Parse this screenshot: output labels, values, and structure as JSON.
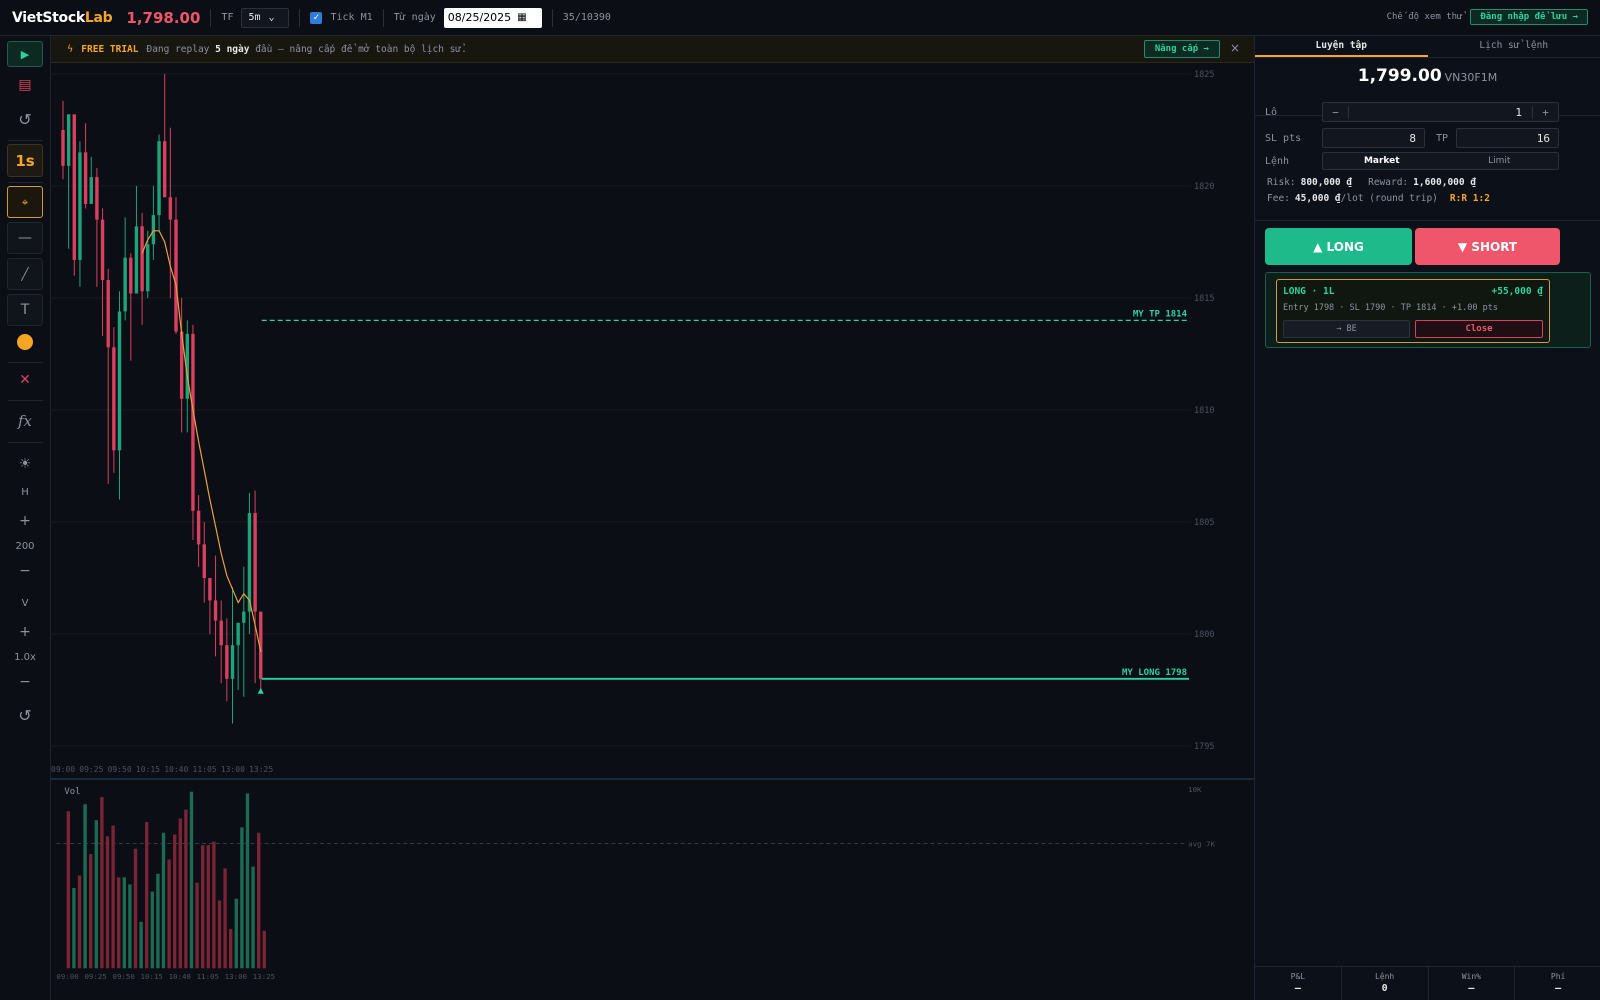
{
  "app": {
    "logo_main": "VietStock",
    "logo_accent": "Lab",
    "price": "1,798.00"
  },
  "topbar": {
    "tf_label": "TF",
    "tf_value": "5m",
    "tick_label": "Tick M1",
    "tick_check": "✓",
    "from_label": "Từ ngày",
    "date_value": "08/25/2025",
    "counter": "35/10390",
    "trial_mode": "Chế độ xem thử",
    "login_label": "Đăng nhập để lưu →"
  },
  "toolbar": {
    "speed": "1s",
    "h_label": "H",
    "h_value": "200",
    "v_label": "V",
    "v_value": "1.0x",
    "plus": "+",
    "minus": "−"
  },
  "banner": {
    "badge": "FREE TRIAL",
    "msg_pre": "Đang replay",
    "msg_bold": "5 ngày",
    "msg_post": "đầu — nâng cấp để mở toàn bộ lịch sử.",
    "upgrade": "Nâng cấp →",
    "close": "×"
  },
  "chart_data": {
    "type": "candlestick",
    "y_ticks": [
      "1825",
      "1820",
      "1815",
      "1810",
      "1805",
      "1800",
      "1795"
    ],
    "y_values": [
      1825,
      1820,
      1815,
      1810,
      1805,
      1800,
      1795
    ],
    "ylim": [
      1794.5,
      1825.5
    ],
    "x_ticks": [
      "09:00",
      "09:25",
      "09:50",
      "10:15",
      "10:40",
      "11:05",
      "13:00",
      "13:25"
    ],
    "tp_label": "MY TP 1814",
    "tp_value": 1814,
    "entry_label": "MY LONG 1798",
    "entry_value": 1798,
    "colors": {
      "up": "#1fa37a",
      "down": "#d9405f",
      "ma": "#e8a23a",
      "tp": "#27d3a0"
    },
    "candles": [
      [
        1822.5,
        1823.8,
        1820.3,
        1820.9
      ],
      [
        1820.9,
        1821.4,
        1817.2,
        1823.2
      ],
      [
        1823.2,
        1823.0,
        1816.0,
        1816.7
      ],
      [
        1816.7,
        1822.0,
        1815.5,
        1821.5
      ],
      [
        1821.5,
        1822.8,
        1819.0,
        1819.2
      ],
      [
        1819.2,
        1821.3,
        1819.4,
        1820.4
      ],
      [
        1820.4,
        1820.8,
        1815.5,
        1818.5
      ],
      [
        1818.5,
        1819.0,
        1813.3,
        1815.8
      ],
      [
        1815.8,
        1816.3,
        1806.7,
        1812.8
      ],
      [
        1812.8,
        1813.7,
        1807.2,
        1808.2
      ],
      [
        1808.2,
        1815.3,
        1806.0,
        1814.4
      ],
      [
        1814.4,
        1818.6,
        1814.0,
        1816.8
      ],
      [
        1816.8,
        1817.0,
        1812.2,
        1815.2
      ],
      [
        1815.2,
        1820.0,
        1815.4,
        1818.2
      ],
      [
        1818.2,
        1818.8,
        1813.8,
        1815.3
      ],
      [
        1815.3,
        1818.0,
        1815.0,
        1817.4
      ],
      [
        1817.4,
        1820.0,
        1816.7,
        1818.7
      ],
      [
        1818.7,
        1822.3,
        1818.0,
        1822.0
      ],
      [
        1822.0,
        1825.0,
        1819.5,
        1819.5
      ],
      [
        1819.5,
        1822.6,
        1815.0,
        1818.5
      ],
      [
        1818.5,
        1819.5,
        1813.4,
        1813.5
      ],
      [
        1813.5,
        1815.0,
        1809.0,
        1810.5
      ],
      [
        1810.5,
        1814.0,
        1809.0,
        1813.4
      ],
      [
        1813.4,
        1813.8,
        1804.2,
        1805.5
      ],
      [
        1805.5,
        1806.2,
        1803.0,
        1804.0
      ],
      [
        1804.0,
        1805.0,
        1801.4,
        1802.5
      ],
      [
        1802.5,
        1802.3,
        1800.0,
        1801.5
      ],
      [
        1801.5,
        1803.5,
        1799.0,
        1800.6
      ],
      [
        1800.6,
        1801.5,
        1797.8,
        1799.5
      ],
      [
        1799.5,
        1800.7,
        1797.0,
        1798.0
      ],
      [
        1798.0,
        1802.1,
        1796.0,
        1799.5
      ],
      [
        1799.5,
        1800.0,
        1797.5,
        1800.5
      ],
      [
        1800.5,
        1803.0,
        1797.2,
        1801.0
      ],
      [
        1801.0,
        1806.3,
        1800.0,
        1805.4
      ],
      [
        1805.4,
        1806.4,
        1797.8,
        1801.0
      ],
      [
        1801.0,
        1800.5,
        1797.5,
        1798.0
      ]
    ],
    "ma": [
      null,
      null,
      null,
      null,
      null,
      null,
      null,
      null,
      null,
      null,
      null,
      null,
      null,
      null,
      1817.0,
      1817.6,
      1818.0,
      1818.0,
      1817.5,
      1816.4,
      1815.6,
      1813.4,
      1811.5,
      1810.0,
      1808.6,
      1807.3,
      1806.0,
      1804.8,
      1803.6,
      1802.6,
      1802.0,
      1801.4,
      1801.8,
      1801.5,
      1800.4,
      1799.2
    ],
    "vol_label": "Vol",
    "vol_max_label": "10K",
    "vol_avg_label": "avg 7K",
    "vol_max": 10000,
    "vol_avg": 7000,
    "volumes": [
      8800,
      4500,
      5200,
      9200,
      6400,
      8300,
      9600,
      7400,
      8000,
      5100,
      5100,
      4700,
      6700,
      2600,
      8200,
      4300,
      5300,
      7600,
      6100,
      7500,
      8400,
      8900,
      9900,
      4800,
      6900,
      6900,
      7100,
      3800,
      5600,
      2200,
      3900,
      7900,
      9800,
      5700,
      7600,
      2100
    ]
  },
  "panel": {
    "tab_practice": "Luyện tập",
    "tab_history": "Lịch sử lệnh",
    "price": "1,799.00",
    "symbol": "VN30F1M",
    "lot_label": "Lô",
    "lot_value": "1",
    "lot_minus": "−",
    "lot_plus": "+",
    "sl_label": "SL pts",
    "sl_value": "8",
    "tp_label": "TP",
    "tp_value": "16",
    "order_label": "Lệnh",
    "order_market": "Market",
    "order_limit": "Limit",
    "risk_label": "Risk:",
    "risk_value": "800,000 ₫",
    "reward_label": "Reward:",
    "reward_value": "1,600,000 ₫",
    "fee_label": "Fee:",
    "fee_value": "45,000 ₫",
    "fee_suffix": "/lot (round trip)",
    "rr": "R:R 1:2",
    "long": "▲ LONG",
    "short": "▼ SHORT",
    "pos_title": "LONG · 1L",
    "pos_pnl": "+55,000 ₫",
    "pos_detail": "Entry 1798 · SL 1790 · TP 1814 · +1.00 pts",
    "pos_be": "→ BE",
    "pos_close": "Close",
    "stats": [
      {
        "k": "P&L",
        "v": "—"
      },
      {
        "k": "Lệnh",
        "v": "0"
      },
      {
        "k": "Win%",
        "v": "—"
      },
      {
        "k": "Phí",
        "v": "—"
      }
    ]
  }
}
